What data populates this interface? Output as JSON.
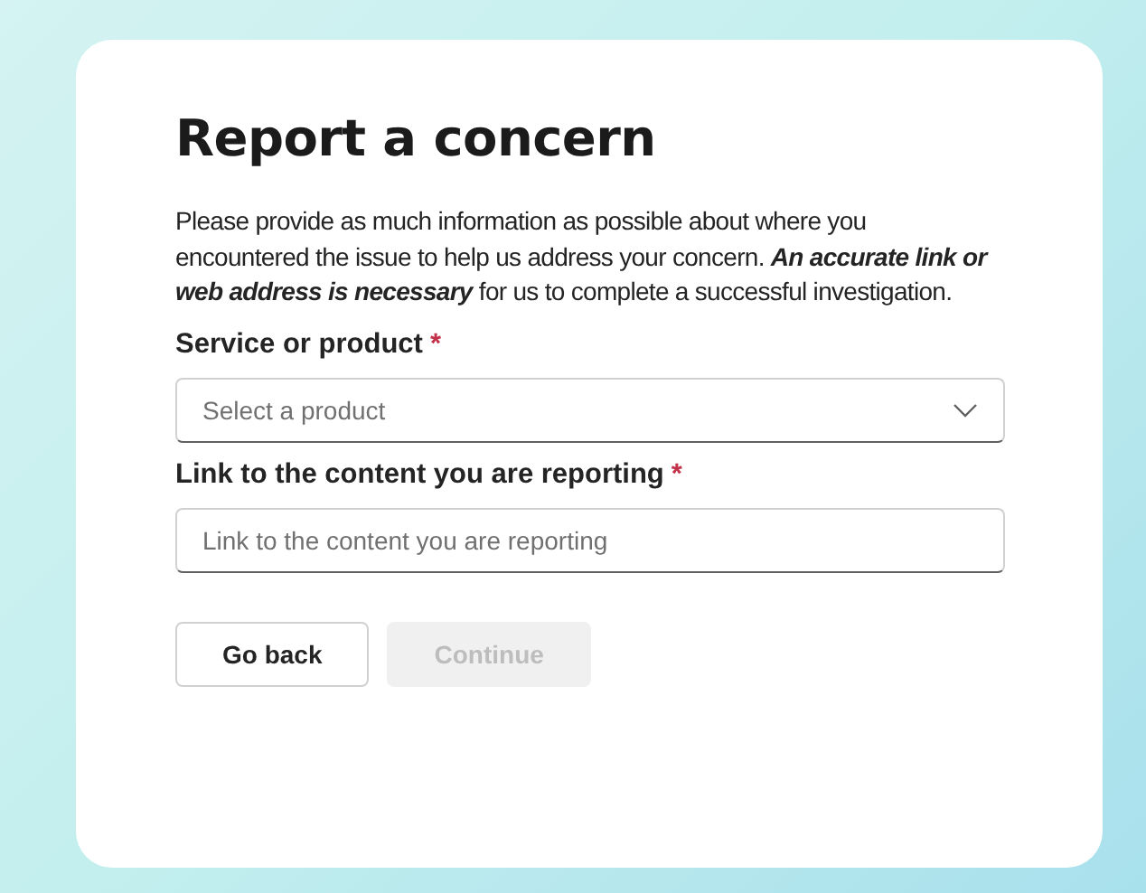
{
  "dialog": {
    "title": "Report a concern",
    "description": "Please provide as much information as possible about where you encountered the issue to help us address your concern. **An accurate link or web address is necessary** for us to complete a successful investigation.",
    "fields": [
      {
        "kind": "select",
        "label": "Service or product",
        "required_mark": "*",
        "placeholder": "Select a product"
      },
      {
        "kind": "text",
        "label": "Link to the content you are reporting",
        "required_mark": "*",
        "placeholder": "Link to the content you are reporting"
      }
    ],
    "buttons": [
      {
        "label": "Go back",
        "disabled": false
      },
      {
        "label": "Continue",
        "disabled": true
      }
    ]
  }
}
